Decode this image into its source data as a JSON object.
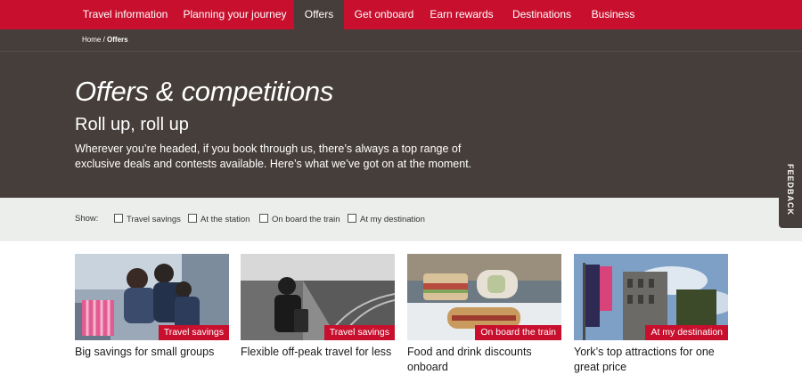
{
  "nav": {
    "items": [
      {
        "label": "Travel information"
      },
      {
        "label": "Planning your journey"
      },
      {
        "label": "Offers",
        "active": true
      },
      {
        "label": "Get onboard"
      },
      {
        "label": "Earn rewards"
      },
      {
        "label": "Destinations"
      },
      {
        "label": "Business"
      }
    ]
  },
  "breadcrumb": {
    "home": "Home",
    "separator": " / ",
    "current": "Offers"
  },
  "hero": {
    "title": "Offers & competitions",
    "subtitle": "Roll up, roll up",
    "description": "Wherever you’re headed, if you book through us, there’s always a top range of exclusive deals and contests available. Here’s what we’ve got on at the moment."
  },
  "filters": {
    "show_label": "Show:",
    "options": [
      {
        "label": "Travel savings",
        "checked": false
      },
      {
        "label": "At the station",
        "checked": false
      },
      {
        "label": "On board the train",
        "checked": false
      },
      {
        "label": "At my destination",
        "checked": false
      }
    ]
  },
  "feedback": {
    "label": "FEEDBACK"
  },
  "cards": [
    {
      "tag": "Travel savings",
      "title": "Big savings for small groups",
      "image": "group-selfie-photo"
    },
    {
      "tag": "Travel savings",
      "title": "Flexible off-peak travel for less",
      "image": "platform-traveller-photo"
    },
    {
      "tag": "On board the train",
      "title": "Food and drink discounts onboard",
      "image": "sandwiches-photo"
    },
    {
      "tag": "At my destination",
      "title": "York’s top attractions for one great price",
      "image": "yorkshire-museum-photo"
    }
  ],
  "colors": {
    "brand_red": "#c8102e",
    "hero_brown": "#463e3a",
    "filter_bg": "#eceeec"
  }
}
